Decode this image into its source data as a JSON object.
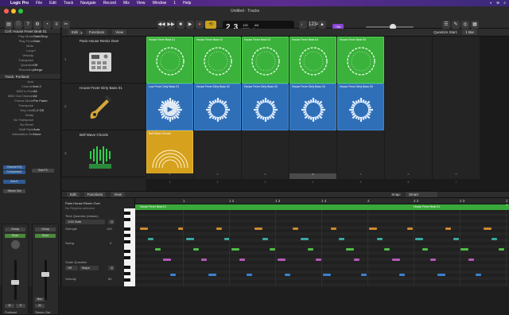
{
  "menubar": {
    "apple": "",
    "app": "Logic Pro",
    "items": [
      "File",
      "Edit",
      "Track",
      "Navigate",
      "Record",
      "Mix",
      "View",
      "Window",
      "1",
      "Help"
    ]
  },
  "window": {
    "title": "Untitled - Tracks"
  },
  "lcd": {
    "bar": "2",
    "beat": "3",
    "tempo": "122",
    "tempo_label": "bpm",
    "key": "Cmin",
    "signature": "4/4",
    "keep": "KEEP"
  },
  "badge": "+54",
  "inspector": {
    "cell_header": "Cell: House Fever Beat 01",
    "props": [
      {
        "label": "Play Mode",
        "value": "Start/Stop"
      },
      {
        "label": "Play From",
        "value": "Start"
      },
      {
        "label": "Mute",
        "value": ""
      },
      {
        "label": "Loop",
        "value": "✓"
      },
      {
        "label": "Velocity",
        "value": ""
      },
      {
        "label": "Transpose",
        "value": ""
      },
      {
        "label": "Quantize",
        "value": "Off"
      },
      {
        "label": "Recording",
        "value": "Merge"
      }
    ],
    "track_header": "Track: Portland",
    "track_props": [
      {
        "label": "Icon",
        "value": ""
      },
      {
        "label": "Channel",
        "value": "Inst 2"
      },
      {
        "label": "MIDI In Port",
        "value": "All"
      },
      {
        "label": "MIDI Out Channel",
        "value": "All"
      },
      {
        "label": "Freeze Mode",
        "value": "Pre Fader"
      },
      {
        "label": "Transpose",
        "value": ""
      },
      {
        "label": "Key Limit",
        "value": "C-2  G8"
      },
      {
        "label": "Delay",
        "value": ""
      },
      {
        "label": "No Transpose",
        "value": ""
      },
      {
        "label": "No Reset",
        "value": ""
      },
      {
        "label": "Staff Style",
        "value": "Auto"
      },
      {
        "label": "Articulation Set",
        "value": "None"
      }
    ],
    "channel_eq": "Channel EQ",
    "compressor": "Compressor",
    "bus": "Bus 6",
    "stereo_out": "Stereo Out",
    "group": "Group",
    "read": "Read",
    "bnc": "Bnc",
    "strip_names": [
      "Portland",
      "Stereo Out"
    ],
    "mute": "M",
    "solo": "S"
  },
  "track_toolbar": {
    "edit": "Edit",
    "functions": "Functions",
    "view": "View",
    "quantize_label": "Quantize Start:",
    "quantize_value": "1 Bar"
  },
  "tracks": [
    {
      "num": "1",
      "name": "Paris House Remix Over",
      "icon": "drum-machine-icon"
    },
    {
      "num": "2",
      "name": "House Fever Dirty Bass 01",
      "icon": "bass-guitar-icon"
    },
    {
      "num": "3",
      "name": "Bell Wave Chords",
      "icon": "synth-icon"
    }
  ],
  "cells": [
    [
      {
        "label": "House Fever Beat 01",
        "color": "green"
      },
      {
        "label": "House Fever Beat 02",
        "color": "green"
      },
      {
        "label": "House Fever Beat 03",
        "color": "green"
      },
      {
        "label": "House Fever Beat 04",
        "color": "green"
      },
      {
        "label": "House Fever Beat 05",
        "color": "green"
      },
      {
        "label": "",
        "color": "empty"
      },
      {
        "label": "",
        "color": "empty"
      }
    ],
    [
      {
        "label": "Low Fever Dirty Bass 01",
        "color": "blue"
      },
      {
        "label": "House Fever Dirty Bass 02",
        "color": "blue"
      },
      {
        "label": "House Fever Dirty Bass 03",
        "color": "blue"
      },
      {
        "label": "House Fever Dirty Bass 04",
        "color": "blue"
      },
      {
        "label": "House Fever Dirty Bass 05",
        "color": "blue"
      },
      {
        "label": "",
        "color": "empty"
      },
      {
        "label": "",
        "color": "empty"
      }
    ],
    [
      {
        "label": "Bell Wave Chords",
        "color": "yellow"
      },
      {
        "label": "",
        "color": "empty"
      },
      {
        "label": "",
        "color": "empty"
      },
      {
        "label": "",
        "color": "empty"
      },
      {
        "label": "",
        "color": "empty"
      },
      {
        "label": "",
        "color": "empty"
      },
      {
        "label": "",
        "color": "empty"
      }
    ]
  ],
  "columns": [
    "1",
    "2",
    "3",
    "4",
    "5",
    "6",
    "7"
  ],
  "piano_toolbar": {
    "edit": "Edit",
    "functions": "Functions",
    "view": "View",
    "snap_label": "Snap:",
    "snap_value": "Smart"
  },
  "piano_left": {
    "region_name": "Paris House Remix Over",
    "region_sub": "No Regions selected",
    "time_quantize": "Time Quantize (classic)",
    "note_value": "1/16 Note",
    "q": "Q",
    "strength": "Strength",
    "strength_val": "100",
    "swing": "Swing",
    "swing_val": "0",
    "scale_quantize": "Scale Quantize",
    "scale_off": "Off",
    "scale_major": "Major",
    "velocity": "Velocity",
    "velocity_val": "80"
  },
  "ruler": [
    "1",
    "1 2",
    "1 3",
    "1 4",
    "2",
    "2 2",
    "2 3",
    "2 4"
  ],
  "region_labels": [
    "House Fever Beat 01",
    "House Fever Beat 01"
  ]
}
